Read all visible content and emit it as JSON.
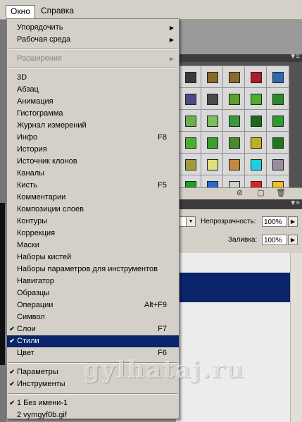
{
  "menubar": {
    "items": [
      {
        "label": "Окно",
        "active": true
      },
      {
        "label": "Справка",
        "active": false
      }
    ]
  },
  "dropdown": {
    "items": [
      {
        "label": "Упорядочить",
        "submenu": true
      },
      {
        "label": "Рабочая среда",
        "submenu": true
      },
      {
        "sep": true
      },
      {
        "label": "Расширения",
        "submenu": true,
        "disabled": true
      },
      {
        "sep": true
      },
      {
        "label": "3D"
      },
      {
        "label": "Абзац"
      },
      {
        "label": "Анимация"
      },
      {
        "label": "Гистограмма"
      },
      {
        "label": "Журнал измерений"
      },
      {
        "label": "Инфо",
        "shortcut": "F8"
      },
      {
        "label": "История"
      },
      {
        "label": "Источник клонов"
      },
      {
        "label": "Каналы"
      },
      {
        "label": "Кисть",
        "shortcut": "F5"
      },
      {
        "label": "Комментарии"
      },
      {
        "label": "Композиции слоев"
      },
      {
        "label": "Контуры"
      },
      {
        "label": "Коррекция"
      },
      {
        "label": "Маски"
      },
      {
        "label": "Наборы кистей"
      },
      {
        "label": "Наборы параметров для инструментов"
      },
      {
        "label": "Навигатор"
      },
      {
        "label": "Образцы"
      },
      {
        "label": "Операции",
        "shortcut": "Alt+F9"
      },
      {
        "label": "Символ"
      },
      {
        "label": "Слои",
        "shortcut": "F7",
        "checked": true
      },
      {
        "label": "Стили",
        "checked": true,
        "selected": true
      },
      {
        "label": "Цвет",
        "shortcut": "F6"
      },
      {
        "sep": true
      },
      {
        "label": "Параметры",
        "checked": true
      },
      {
        "label": "Инструменты",
        "checked": true
      },
      {
        "sep": true
      },
      {
        "label": "1 Без имени-1",
        "checked": true
      },
      {
        "label": "2 vymgyf0b.gif"
      }
    ]
  },
  "layers_panel": {
    "opacity_label": "Непрозрачность:",
    "opacity_value": "100%",
    "fill_label": "Заливка:",
    "fill_value": "100%"
  },
  "styles_panel": {
    "swatch_colors": [
      [
        "#3a3a3a",
        "#8a6a2a",
        "#8a6a2a",
        "#b01a2a",
        "#2a6ab0"
      ],
      [
        "#4a4a8a",
        "#4a4a4a",
        "#5aa02a",
        "#4ab02a",
        "#2a8a2a"
      ],
      [
        "#6ab04a",
        "#7ac05a",
        "#3a9a3a",
        "#1a6a1a",
        "#2a9a2a"
      ],
      [
        "#4ab02a",
        "#3aa02a",
        "#4a8a2a",
        "#c0b01a",
        "#1a7a1a"
      ],
      [
        "#a09a3a",
        "#e0e07a",
        "#c08a3a",
        "#1ad0e0",
        "#9a8aa0"
      ],
      [
        "#20a020",
        "#2a6ad0",
        "#d0d0d0",
        "#e02020",
        "#f0c020"
      ]
    ]
  },
  "watermark": "gylhataj.ru"
}
